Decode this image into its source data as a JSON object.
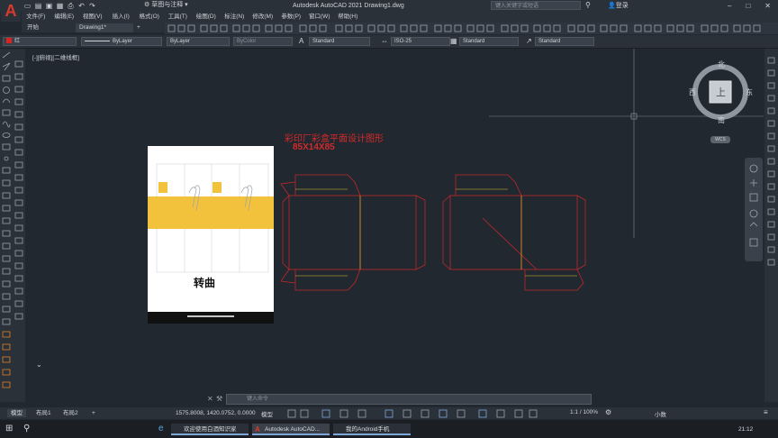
{
  "app": {
    "logo_letter": "A",
    "workspace": "草图与注释",
    "title": "Autodesk AutoCAD 2021   Drawing1.dwg",
    "search_placeholder": "键入关键字或短语",
    "user": "登录"
  },
  "menu": [
    "文件(F)",
    "编辑(E)",
    "视图(V)",
    "插入(I)",
    "格式(O)",
    "工具(T)",
    "绘图(D)",
    "标注(N)",
    "修改(M)",
    "参数(P)",
    "窗口(W)",
    "帮助(H)"
  ],
  "tabs": {
    "start": "开始",
    "drawing": "Drawing1*",
    "add": "+"
  },
  "properties": {
    "color": "红",
    "linetype": "ByLayer",
    "lineweight": "ByLayer",
    "plotstyle": "ByColor",
    "text_style": "Standard",
    "dim_style": "ISO-25",
    "table_style": "Standard",
    "mleader_style": "Standard"
  },
  "viewport_label": "[-][俯视][二维线框]",
  "drawing": {
    "title_line1": "彩印厂彩盒平面设计图形",
    "title_line2": "85X14X85",
    "package_text": "转曲"
  },
  "viewcube": {
    "north": "北",
    "south": "南",
    "east": "东",
    "west": "西",
    "top": "上",
    "wcs": "WCS"
  },
  "command_placeholder": "键入命令",
  "status": {
    "model_tab": "模型",
    "layout1": "布局1",
    "layout2": "布局2",
    "coords": "1575.8008, 1420.0752, 0.0000",
    "model_btn": "模型",
    "scale": "1:1 / 100%",
    "units": "小数"
  },
  "taskbar": {
    "item1": "欢迎使用白酒知识家",
    "item2": "Autodesk AutoCAD...",
    "item3": "我的Android手机",
    "time": "21:12"
  }
}
